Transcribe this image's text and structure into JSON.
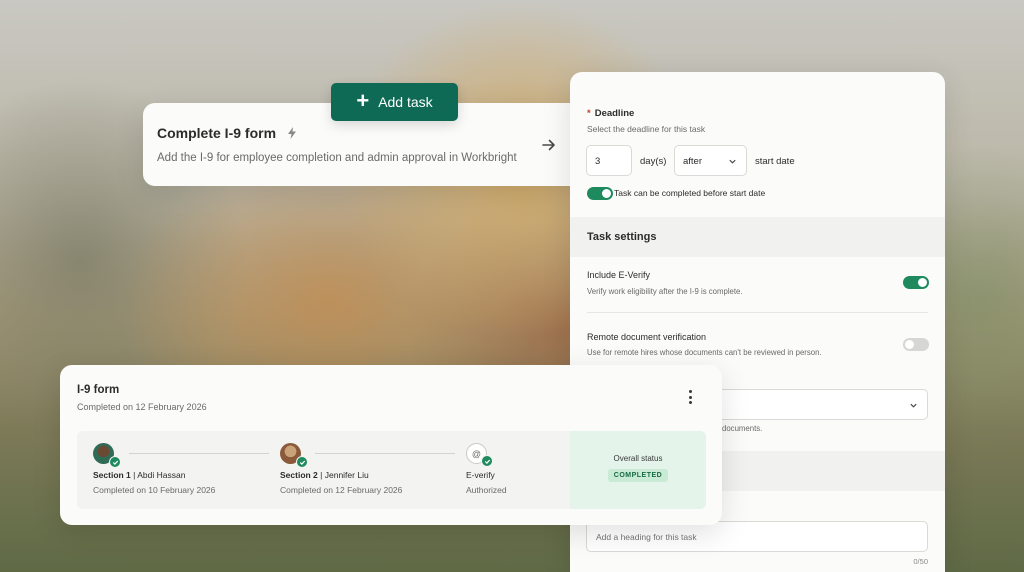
{
  "add_task": {
    "label": "Add task"
  },
  "task_card": {
    "title": "Complete I-9 form",
    "description": "Add the I-9 for employee completion and admin approval in Workbright"
  },
  "deadline": {
    "label": "Deadline",
    "required_marker": "*",
    "subtitle": "Select the deadline for this task",
    "days_value": "3",
    "days_unit": "day(s)",
    "relation": "after",
    "anchor": "start date",
    "early_completion_label": "Task can be completed before start date",
    "early_completion_enabled": true
  },
  "task_settings": {
    "title": "Task settings",
    "everify": {
      "title": "Include E-Verify",
      "subtitle": "Verify work eligibility after the I-9 is complete.",
      "enabled": true
    },
    "remote": {
      "title": "Remote document verification",
      "subtitle": "Use for remote hires whose documents can't be reviewed in person.",
      "enabled": false
    },
    "documents_note": "documents.",
    "heading_placeholder": "Add a heading for this task",
    "heading_counter": "0/50"
  },
  "i9_card": {
    "title": "I-9 form",
    "subtitle": "Completed on 12 February 2026",
    "steps": [
      {
        "section": "Section 1",
        "person": "Abdi Hassan",
        "date": "Completed on 10 February 2026"
      },
      {
        "section": "Section 2",
        "person": "Jennifer Liu",
        "date": "Completed on 12 February 2026"
      },
      {
        "section": "E-verify",
        "person": "",
        "date": "Authorized"
      }
    ],
    "overall_label": "Overall status",
    "overall_badge": "COMPLETED"
  },
  "colors": {
    "brand": "#0f6a55",
    "toggle_on": "#1f8a5e",
    "success_bg": "#e4f4ea"
  }
}
